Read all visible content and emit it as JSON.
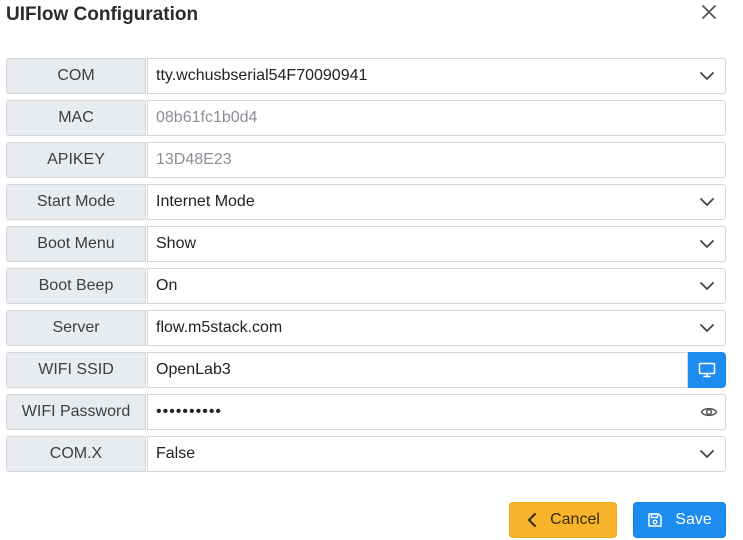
{
  "dialog": {
    "title": "UIFlow Configuration",
    "close_icon": "close-icon"
  },
  "fields": {
    "com": {
      "label": "COM",
      "value": "tty.wchusbserial54F70090941"
    },
    "mac": {
      "label": "MAC",
      "value": "08b61fc1b0d4"
    },
    "apikey": {
      "label": "APIKEY",
      "value": "13D48E23"
    },
    "start_mode": {
      "label": "Start Mode",
      "value": "Internet Mode"
    },
    "boot_menu": {
      "label": "Boot Menu",
      "value": "Show"
    },
    "boot_beep": {
      "label": "Boot Beep",
      "value": "On"
    },
    "server": {
      "label": "Server",
      "value": "flow.m5stack.com"
    },
    "wifi_ssid": {
      "label": "WIFI SSID",
      "value": "OpenLab3"
    },
    "wifi_password": {
      "label": "WIFI Password",
      "value": "••••••••••"
    },
    "comx": {
      "label": "COM.X",
      "value": "False"
    }
  },
  "buttons": {
    "cancel": "Cancel",
    "save": "Save"
  },
  "colors": {
    "primary": "#1c8cf0",
    "warning": "#f8b52b",
    "label_bg": "#e9ecef"
  }
}
